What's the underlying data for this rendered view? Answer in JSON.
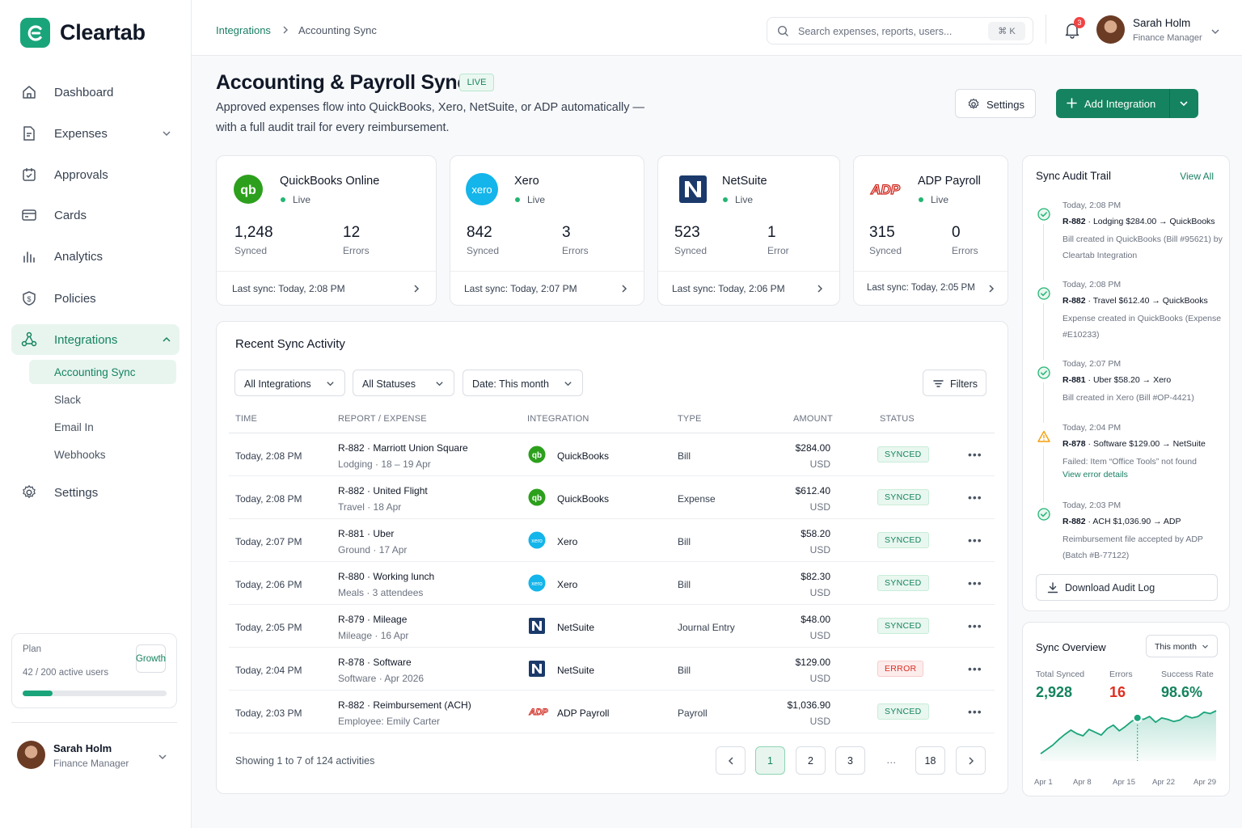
{
  "brand": {
    "name": "Cleartab",
    "color": "#1aa47a",
    "accent": "#15835f"
  },
  "nav": {
    "items": [
      {
        "label": "Dashboard",
        "icon": "home-icon"
      },
      {
        "label": "Expenses",
        "icon": "receipt-icon"
      },
      {
        "label": "Approvals",
        "icon": "calendar-check-icon"
      },
      {
        "label": "Cards",
        "icon": "card-icon"
      },
      {
        "label": "Analytics",
        "icon": "bar-chart-icon"
      },
      {
        "label": "Policies",
        "icon": "shield-dollar-icon"
      },
      {
        "label": "Integrations",
        "icon": "integrations-icon"
      },
      {
        "label": "Settings",
        "icon": "gear-icon"
      }
    ],
    "sub_items": [
      "Accounting Sync",
      "Slack",
      "Email In",
      "Webhooks"
    ]
  },
  "plan": {
    "label": "Plan",
    "tier": "Growth",
    "usage": "42 / 200 active users",
    "usage_fraction": 0.21
  },
  "user": {
    "name": "Sarah Holm",
    "role": "Finance Manager"
  },
  "topbar": {
    "breadcrumb": [
      "Integrations",
      "Accounting Sync"
    ],
    "search_placeholder": "Search expenses, reports, users...",
    "shortcut": "⌘ K",
    "notifications": "3"
  },
  "page": {
    "title": "Accounting & Payroll Sync",
    "status": "LIVE",
    "subtitle": "Approved expenses flow into QuickBooks, Xero, NetSuite, or ADP automatically — with a full audit trail for every reimbursement.",
    "settings_label": "Settings",
    "add_label": "Add Integration"
  },
  "integrations": [
    {
      "name": "QuickBooks Online",
      "status": "Live",
      "synced": "1,248",
      "synced_label": "Synced",
      "errors": "12",
      "errors_label": "Errors",
      "last_sync": "Last sync: Today, 2:08 PM",
      "logo": "qb"
    },
    {
      "name": "Xero",
      "status": "Live",
      "synced": "842",
      "synced_label": "Synced",
      "errors": "3",
      "errors_label": "Errors",
      "last_sync": "Last sync: Today, 2:07 PM",
      "logo": "xero"
    },
    {
      "name": "NetSuite",
      "status": "Live",
      "synced": "523",
      "synced_label": "Synced",
      "errors": "1",
      "errors_label": "Error",
      "last_sync": "Last sync: Today, 2:06 PM",
      "logo": "N"
    },
    {
      "name": "ADP Payroll",
      "status": "Live",
      "synced": "315",
      "synced_label": "Synced",
      "errors": "0",
      "errors_label": "Errors",
      "last_sync": "Last sync: Today, 2:05 PM",
      "logo": "ADP"
    }
  ],
  "activity": {
    "title": "Recent Sync Activity",
    "filters": [
      "All Integrations",
      "All Statuses",
      "Date: This month"
    ],
    "filters_button": "Filters",
    "columns": [
      "TIME",
      "REPORT / EXPENSE",
      "INTEGRATION",
      "TYPE",
      "AMOUNT",
      "STATUS"
    ],
    "rows": [
      {
        "time": "Today, 2:08 PM",
        "report": "R-882 · Marriott Union Square",
        "detail": "Lodging · 18 – 19 Apr",
        "integration": "QuickBooks",
        "logo": "qb",
        "type": "Bill",
        "amount": "$284.00",
        "currency": "USD",
        "status": "SYNCED"
      },
      {
        "time": "Today, 2:08 PM",
        "report": "R-882 · United Flight",
        "detail": "Travel · 18 Apr",
        "integration": "QuickBooks",
        "logo": "qb",
        "type": "Expense",
        "amount": "$612.40",
        "currency": "USD",
        "status": "SYNCED"
      },
      {
        "time": "Today, 2:07 PM",
        "report": "R-881 · Uber",
        "detail": "Ground · 17 Apr",
        "integration": "Xero",
        "logo": "xero",
        "type": "Bill",
        "amount": "$58.20",
        "currency": "USD",
        "status": "SYNCED"
      },
      {
        "time": "Today, 2:06 PM",
        "report": "R-880 · Working lunch",
        "detail": "Meals · 3 attendees",
        "integration": "Xero",
        "logo": "xero",
        "type": "Bill",
        "amount": "$82.30",
        "currency": "USD",
        "status": "SYNCED"
      },
      {
        "time": "Today, 2:05 PM",
        "report": "R-879 · Mileage",
        "detail": "Mileage · 16 Apr",
        "integration": "NetSuite",
        "logo": "N",
        "type": "Journal Entry",
        "amount": "$48.00",
        "currency": "USD",
        "status": "SYNCED"
      },
      {
        "time": "Today, 2:04 PM",
        "report": "R-878 · Software",
        "detail": "Software · Apr 2026",
        "integration": "NetSuite",
        "logo": "N",
        "type": "Bill",
        "amount": "$129.00",
        "currency": "USD",
        "status": "ERROR"
      },
      {
        "time": "Today, 2:03 PM",
        "report": "R-882 · Reimbursement (ACH)",
        "detail": "Employee: Emily Carter",
        "integration": "ADP Payroll",
        "logo": "ADP",
        "type": "Payroll",
        "amount": "$1,036.90",
        "currency": "USD",
        "status": "SYNCED"
      }
    ],
    "showing": "Showing 1 to 7 of 124 activities",
    "pages": [
      "1",
      "2",
      "3",
      "…",
      "18"
    ],
    "current_page": "1"
  },
  "audit": {
    "title": "Sync Audit Trail",
    "view_all": "View All",
    "events": [
      {
        "time": "Today, 2:08 PM",
        "headline": "R-882 · Lodging $284.00 → QuickBooks",
        "detail": "Bill created in QuickBooks (Bill #95621) by Cleartab Integration",
        "kind": "success"
      },
      {
        "time": "Today, 2:08 PM",
        "headline": "R-882 · Travel $612.40 → QuickBooks",
        "detail": "Expense created in QuickBooks (Expense #E10233)",
        "kind": "success"
      },
      {
        "time": "Today, 2:07 PM",
        "headline": "R-881 · Uber $58.20 → Xero",
        "detail": "Bill created in Xero (Bill #OP-4421)",
        "kind": "success"
      },
      {
        "time": "Today, 2:04 PM",
        "headline": "R-878 · Software $129.00 → NetSuite",
        "detail": "Failed: Item “Office Tools” not found",
        "link": "View error details",
        "kind": "warning"
      },
      {
        "time": "Today, 2:03 PM",
        "headline": "R-882 · ACH $1,036.90 → ADP",
        "detail": "Reimbursement file accepted by ADP (Batch #B-77122)",
        "kind": "success"
      }
    ],
    "download_label": "Download Audit Log"
  },
  "overview": {
    "title": "Sync Overview",
    "range": "This month",
    "total_label": "Total Synced",
    "total": "2,928",
    "errors_label": "Errors",
    "errors": "16",
    "rate_label": "Success Rate",
    "rate": "98.6%",
    "x_labels": [
      "Apr 1",
      "Apr 8",
      "Apr 15",
      "Apr 22",
      "Apr 29"
    ]
  },
  "chart_data": {
    "type": "area",
    "x": [
      "Apr 1",
      "Apr 2",
      "Apr 3",
      "Apr 4",
      "Apr 5",
      "Apr 6",
      "Apr 7",
      "Apr 8",
      "Apr 9",
      "Apr 10",
      "Apr 11",
      "Apr 12",
      "Apr 13",
      "Apr 14",
      "Apr 15",
      "Apr 16",
      "Apr 17",
      "Apr 18",
      "Apr 19",
      "Apr 20",
      "Apr 21",
      "Apr 22",
      "Apr 23",
      "Apr 24",
      "Apr 25",
      "Apr 26",
      "Apr 27",
      "Apr 28",
      "Apr 29",
      "Apr 30"
    ],
    "values": [
      10,
      16,
      22,
      30,
      37,
      43,
      38,
      35,
      44,
      40,
      36,
      45,
      50,
      42,
      48,
      55,
      60,
      58,
      62,
      54,
      60,
      58,
      55,
      57,
      63,
      60,
      62,
      68,
      66,
      70
    ],
    "highlight_index": 16,
    "xlabel": "",
    "ylabel": "",
    "color": "#1aa47a"
  }
}
